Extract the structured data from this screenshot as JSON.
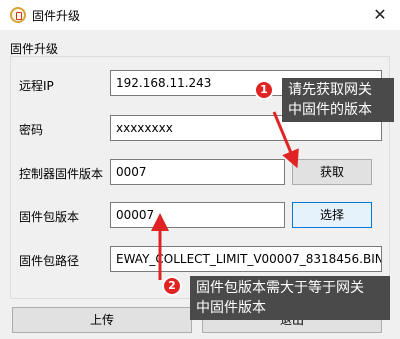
{
  "window": {
    "title": "固件升级",
    "close_glyph": "✕"
  },
  "group": {
    "title": "固件升级"
  },
  "form": {
    "remote_ip": {
      "label": "远程IP",
      "value": "192.168.11.243"
    },
    "password": {
      "label": "密码",
      "value": "xxxxxxxx"
    },
    "controller_fw_version": {
      "label": "控制器固件版本",
      "value": "0007"
    },
    "package_version": {
      "label": "固件包版本",
      "value": "00007"
    },
    "package_path": {
      "label": "固件包路径",
      "value": "EWAY_COLLECT_LIMIT_V00007_8318456.BIN"
    }
  },
  "buttons": {
    "fetch": "获取",
    "select": "选择",
    "upload": "上传",
    "exit": "退出"
  },
  "annotations": {
    "callout_1": {
      "number": "1",
      "text_line1": "请先获取网关",
      "text_line2": "中固件的版本"
    },
    "callout_2": {
      "number": "2",
      "text_line1": "固件包版本需大于等于网关",
      "text_line2": "中固件版本"
    }
  },
  "colors": {
    "annotation_red": "#e02424",
    "callout_bg": "#4a4a4a",
    "focus_blue": "#0078d7"
  }
}
